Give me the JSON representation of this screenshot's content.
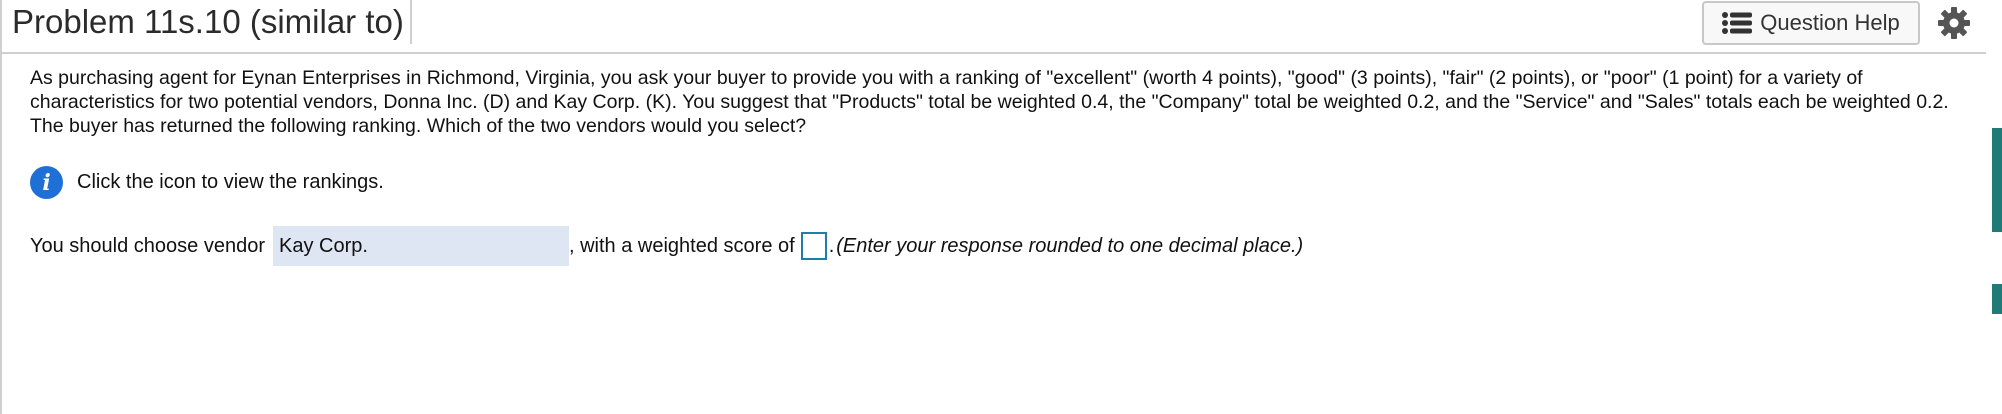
{
  "header": {
    "title": "Problem 11s.10 (similar to)",
    "question_help_label": "Question Help",
    "question_help_icon": "list-icon",
    "settings_icon": "gear-icon"
  },
  "problem": {
    "text": "As purchasing agent for Eynan Enterprises in Richmond, Virginia, you ask your buyer to provide you with a ranking of \"excellent\" (worth 4 points), \"good\" (3 points), \"fair\" (2 points), or \"poor\"  (1 point) for a variety of characteristics for two potential vendors, Donna Inc. (D) and Kay Corp. (K). You suggest that \"Products\" total be weighted 0.4, the \"Company\" total be weighted 0.2, and the \"Service\" and \"Sales\" totals each be weighted 0.2. The buyer has returned the following ranking. Which of the two vendors would you select?"
  },
  "info": {
    "text": "Click the icon to view the rankings.",
    "icon": "info-icon"
  },
  "answer": {
    "prefix": "You should choose vendor",
    "selected_vendor": "Kay Corp.",
    "middle": ", with a weighted score of",
    "score_value": "",
    "period": ".",
    "note": "(Enter your response rounded to one decimal place.)"
  },
  "colors": {
    "accent_blue": "#1e6fd6",
    "input_border": "#1d7fa8",
    "select_bg": "#dfe6f3",
    "teal": "#1f7a78"
  }
}
